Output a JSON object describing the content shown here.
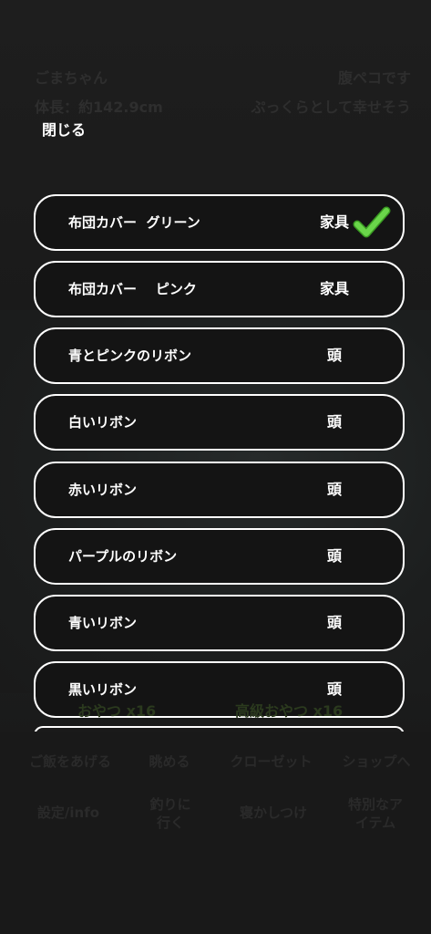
{
  "status": {
    "pet_name": "ごまちゃん",
    "length": "体長：約142.9cm",
    "hunger": "腹ペコです",
    "mood": "ぷっくらとして幸せそう"
  },
  "close_label": "閉じる",
  "items": [
    {
      "name": "布団カバー  グリーン",
      "category": "家具",
      "equipped": true
    },
    {
      "name": "布団カバー    ピンク",
      "category": "家具",
      "equipped": false
    },
    {
      "name": "青とピンクのリボン",
      "category": "頭",
      "equipped": false
    },
    {
      "name": "白いリボン",
      "category": "頭",
      "equipped": false
    },
    {
      "name": "赤いリボン",
      "category": "頭",
      "equipped": false
    },
    {
      "name": "パープルのリボン",
      "category": "頭",
      "equipped": false
    },
    {
      "name": "青いリボン",
      "category": "頭",
      "equipped": false
    },
    {
      "name": "黒いリボン",
      "category": "頭",
      "equipped": false
    }
  ],
  "inventory": {
    "snack": "おやつ x16",
    "premium_snack": "高級おやつ x16"
  },
  "menu": {
    "feed": "ご飯をあげる",
    "watch": "眺める",
    "closet": "クローゼット",
    "shop": "ショップへ",
    "settings": "設定/info",
    "go_fishing": "釣りに行く",
    "sleep": "寝かしつけ",
    "special_items": "特別なアイテム"
  },
  "colors": {
    "check": "#5fd03a",
    "border": "#ffffff",
    "row_bg": "#141414"
  }
}
